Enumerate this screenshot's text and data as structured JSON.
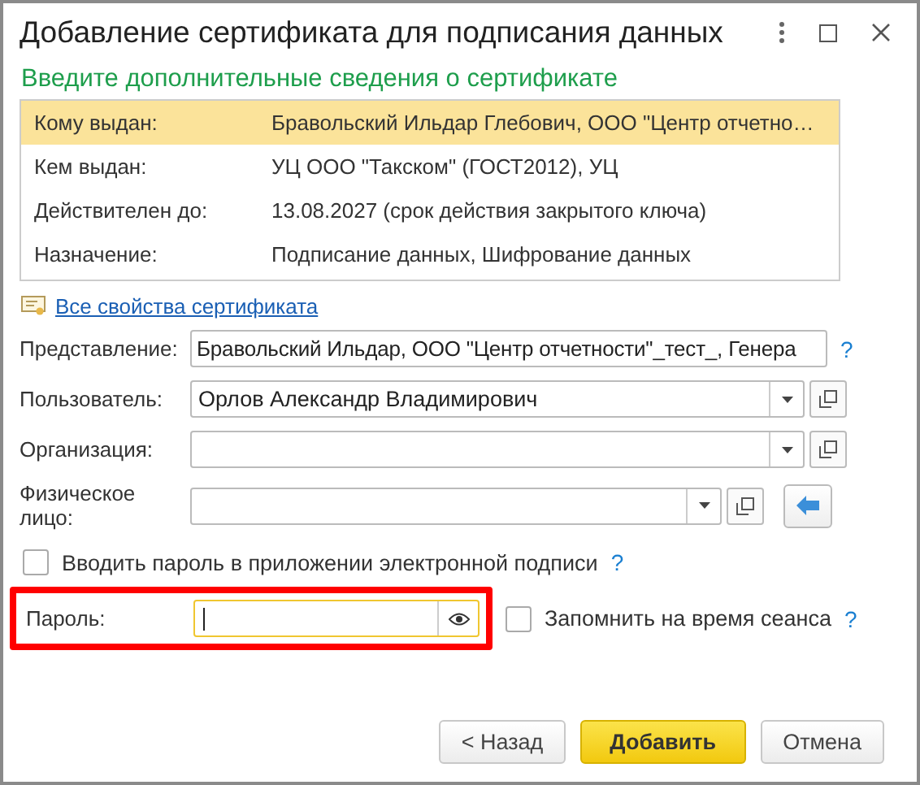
{
  "window": {
    "title": "Добавление сертификата для подписания данных"
  },
  "subtitle": "Введите дополнительные сведения о сертификате",
  "properties": [
    {
      "label": "Кому выдан:",
      "value": "Бравольский Ильдар Глебович, ООО \"Центр отчетно…",
      "selected": true
    },
    {
      "label": "Кем выдан:",
      "value": "УЦ ООО \"Такском\" (ГОСТ2012), УЦ",
      "selected": false
    },
    {
      "label": "Действителен до:",
      "value": "13.08.2027 (срок действия закрытого ключа)",
      "selected": false
    },
    {
      "label": "Назначение:",
      "value": "Подписание данных, Шифрование данных",
      "selected": false
    }
  ],
  "link": "Все свойства сертификата",
  "fields": [
    {
      "kind": "text",
      "label": "Представление:",
      "value": "Бравольский Ильдар, ООО \"Центр отчетности\"_тест_, Генера",
      "help": "?"
    },
    {
      "kind": "select",
      "label": "Пользователь:",
      "value": "Орлов Александр Владимирович"
    },
    {
      "kind": "select",
      "label": "Организация:"
    },
    {
      "kind": "select_action",
      "label": "Физическое лицо:"
    }
  ],
  "enter_in_app": {
    "label": "Вводить пароль в приложении электронной подписи",
    "checked": false,
    "help": "?"
  },
  "password": {
    "label": "Пароль:",
    "focused": true,
    "highlighted": true
  },
  "remember": {
    "label": "Запомнить на время сеанса",
    "checked": false,
    "help": "?"
  },
  "buttons": [
    {
      "label": "< Назад",
      "default": false
    },
    {
      "label": "Добавить",
      "default": true
    },
    {
      "label": "Отмена",
      "default": false
    }
  ]
}
